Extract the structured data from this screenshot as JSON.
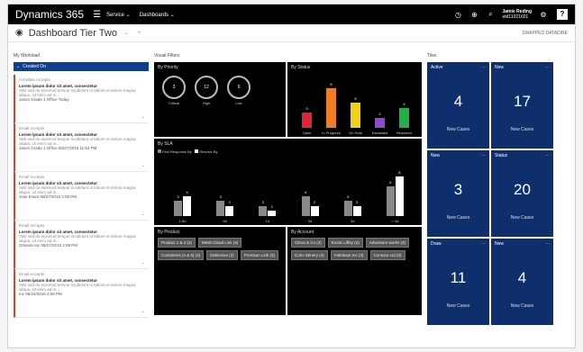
{
  "topbar": {
    "brand": "Dynamics 365",
    "nav": [
      "Service ⌄",
      "Dashboards ⌄"
    ],
    "user_name": "Jamie Reding",
    "user_id": "etd11021601",
    "help": "?"
  },
  "header": {
    "title": "Dashboard Tier Two",
    "filter": "SWAPPED DATADIRE"
  },
  "workload": {
    "label": "My Workload",
    "list_title": "Created On",
    "cards": [
      {
        "meta": "Activities   Accepts",
        "lorem": "Lorem ipsum dolor sit amet, consectetur",
        "text": "Velit sed do eiusmod tempor incididunt ut labore et dolore magna aliqua. Ut enim ad m...",
        "foot": "Jason  Grade 1 Office  Today"
      },
      {
        "meta": "Email   Accepts",
        "lorem": "Lorem ipsum dolor sit amet, consectetur",
        "text": "Velit sed do eiusmod tempor incididunt ut labore et dolore magna aliqua. Ut enim ad m...",
        "foot": "Jason  Grade 1 Office  08/27/2016 11:53 PM"
      },
      {
        "meta": "Email   Accepts",
        "lorem": "Lorem ipsum dolor sit amet, consectetur",
        "text": "Velit sed do eiusmod tempor incididunt ut labore et dolore magna aliqua. Ut enim ad m...",
        "foot": "Jose  Exam  08/27/2016 2:08 PM"
      },
      {
        "meta": "Email   Accepts",
        "lorem": "Lorem ipsum dolor sit amet, consectetur",
        "text": "Velit sed do eiusmod tempor incididunt ut labore et dolore magna aliqua. Ut enim ad m...",
        "foot": "Orlando  Inc  08/27/2016 2:08 PM"
      },
      {
        "meta": "Email   Accepts",
        "lorem": "Lorem ipsum dolor sit amet, consectetur",
        "text": "Velit sed do eiusmod tempor incididunt ut labore et dolore magna aliqua. Ut enim ad m...",
        "foot": "Inc  08/24/2016 2:08 PM"
      }
    ]
  },
  "visual": {
    "label": "Visual Filters",
    "by_priority": {
      "title": "By Priority",
      "items": [
        {
          "value": "3",
          "label": "Critical"
        },
        {
          "value": "12",
          "label": "High"
        },
        {
          "value": "9",
          "label": "Low"
        }
      ]
    },
    "by_status": {
      "title": "By Status",
      "colors": [
        "#e0243a",
        "#f07e22",
        "#f4d01e",
        "#8a4fc6",
        "#22b04a"
      ]
    },
    "by_sla": {
      "title": "By SLA",
      "legend": [
        "First Response By",
        "Resolve By"
      ]
    },
    "by_product": {
      "title": "By Product",
      "tags": [
        "Product 1 & 2 (4)",
        "Mesh Cloud Link (4)",
        "Containers (4 & 5) (4)",
        "Deliveries (3)",
        "Premium Link (3)"
      ]
    },
    "by_account": {
      "title": "By Account",
      "tags": [
        "Citrus & Co (4)",
        "Exotic Liffey (3)",
        "Adventure works (3)",
        "Coho Winery (3)",
        "Fabrikam Inc (3)",
        "Contoso Ltd (3)"
      ]
    }
  },
  "tiles": {
    "label": "Tiles",
    "items": [
      {
        "name": "Active",
        "count": "4",
        "sub": "New Cases"
      },
      {
        "name": "New",
        "count": "17",
        "sub": "New Cases"
      },
      {
        "name": "New",
        "count": "3",
        "sub": "New Cases"
      },
      {
        "name": "Status",
        "count": "20",
        "sub": "New Cases"
      },
      {
        "name": "Draw",
        "count": "11",
        "sub": "New Cases"
      },
      {
        "name": "New",
        "count": "4",
        "sub": "New Cases"
      }
    ]
  },
  "chart_data": [
    {
      "type": "bar",
      "title": "By Status",
      "categories": [
        "Open",
        "In Progress",
        "On Hold",
        "Escalated",
        "Resolved"
      ],
      "values": [
        3,
        8,
        5,
        2,
        4
      ],
      "ylim": [
        0,
        9
      ]
    },
    {
      "type": "bar",
      "title": "By SLA",
      "categories": [
        "1-6h",
        "6h",
        "1d",
        "2d",
        "3d",
        "> 4d"
      ],
      "series": [
        {
          "name": "First Response By",
          "values": [
            3,
            3,
            2,
            4,
            3,
            6
          ]
        },
        {
          "name": "Resolve By",
          "values": [
            4,
            2,
            1,
            2,
            2,
            8
          ]
        }
      ],
      "ylim": [
        0,
        9
      ]
    }
  ]
}
